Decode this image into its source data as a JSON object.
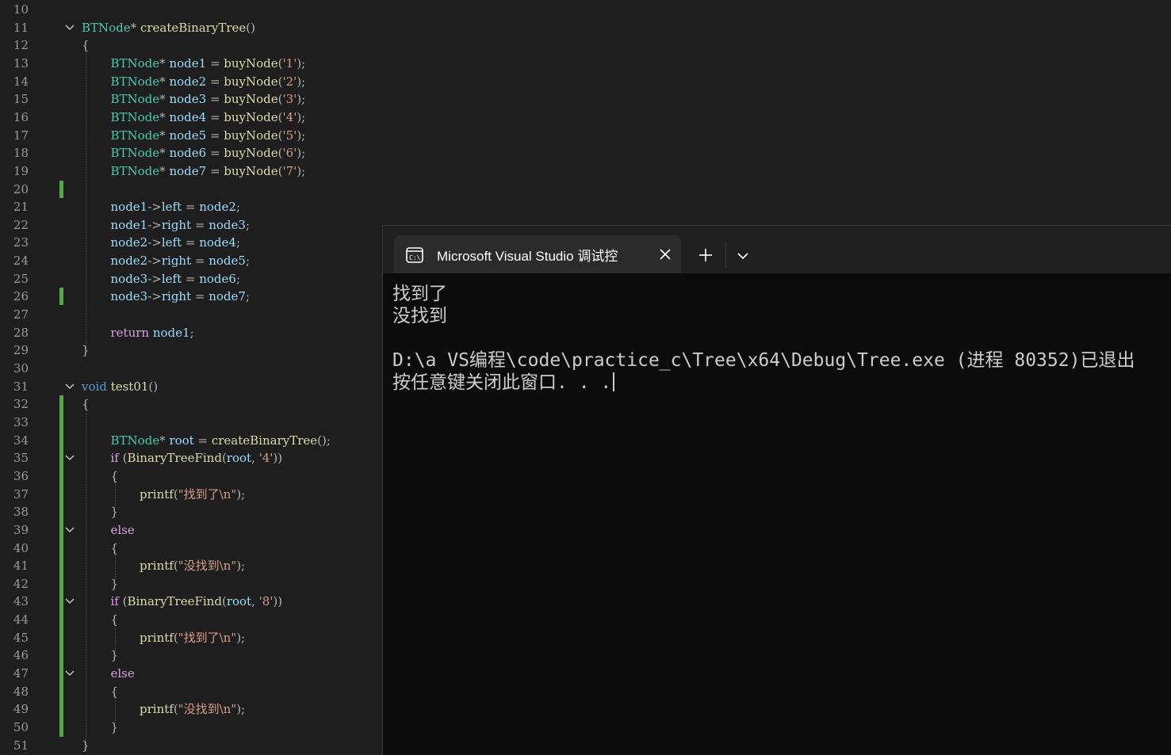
{
  "editor": {
    "lines": [
      {
        "n": "10",
        "tokens": []
      },
      {
        "n": "11",
        "fold": true,
        "indent": 0,
        "tokens": [
          [
            "ty",
            "BTNode"
          ],
          [
            "pun",
            "* "
          ],
          [
            "fn",
            "createBinaryTree"
          ],
          [
            "pun",
            "()"
          ]
        ]
      },
      {
        "n": "12",
        "indent": 0,
        "tokens": [
          [
            "pun",
            "{"
          ]
        ]
      },
      {
        "n": "13",
        "indent": 1,
        "tokens": [
          [
            "ty",
            "BTNode"
          ],
          [
            "pun",
            "* "
          ],
          [
            "var",
            "node1"
          ],
          [
            "pun",
            " = "
          ],
          [
            "fn",
            "buyNode"
          ],
          [
            "pun",
            "("
          ],
          [
            "str",
            "'1'"
          ],
          [
            "pun",
            ");"
          ]
        ]
      },
      {
        "n": "14",
        "indent": 1,
        "tokens": [
          [
            "ty",
            "BTNode"
          ],
          [
            "pun",
            "* "
          ],
          [
            "var",
            "node2"
          ],
          [
            "pun",
            " = "
          ],
          [
            "fn",
            "buyNode"
          ],
          [
            "pun",
            "("
          ],
          [
            "str",
            "'2'"
          ],
          [
            "pun",
            ");"
          ]
        ]
      },
      {
        "n": "15",
        "indent": 1,
        "tokens": [
          [
            "ty",
            "BTNode"
          ],
          [
            "pun",
            "* "
          ],
          [
            "var",
            "node3"
          ],
          [
            "pun",
            " = "
          ],
          [
            "fn",
            "buyNode"
          ],
          [
            "pun",
            "("
          ],
          [
            "str",
            "'3'"
          ],
          [
            "pun",
            ");"
          ]
        ]
      },
      {
        "n": "16",
        "indent": 1,
        "tokens": [
          [
            "ty",
            "BTNode"
          ],
          [
            "pun",
            "* "
          ],
          [
            "var",
            "node4"
          ],
          [
            "pun",
            " = "
          ],
          [
            "fn",
            "buyNode"
          ],
          [
            "pun",
            "("
          ],
          [
            "str",
            "'4'"
          ],
          [
            "pun",
            ");"
          ]
        ]
      },
      {
        "n": "17",
        "indent": 1,
        "tokens": [
          [
            "ty",
            "BTNode"
          ],
          [
            "pun",
            "* "
          ],
          [
            "var",
            "node5"
          ],
          [
            "pun",
            " = "
          ],
          [
            "fn",
            "buyNode"
          ],
          [
            "pun",
            "("
          ],
          [
            "str",
            "'5'"
          ],
          [
            "pun",
            ");"
          ]
        ]
      },
      {
        "n": "18",
        "indent": 1,
        "tokens": [
          [
            "ty",
            "BTNode"
          ],
          [
            "pun",
            "* "
          ],
          [
            "var",
            "node6"
          ],
          [
            "pun",
            " = "
          ],
          [
            "fn",
            "buyNode"
          ],
          [
            "pun",
            "("
          ],
          [
            "str",
            "'6'"
          ],
          [
            "pun",
            ");"
          ]
        ]
      },
      {
        "n": "19",
        "indent": 1,
        "tokens": [
          [
            "ty",
            "BTNode"
          ],
          [
            "pun",
            "* "
          ],
          [
            "var",
            "node7"
          ],
          [
            "pun",
            " = "
          ],
          [
            "fn",
            "buyNode"
          ],
          [
            "pun",
            "("
          ],
          [
            "str",
            "'7'"
          ],
          [
            "pun",
            ");"
          ]
        ]
      },
      {
        "n": "20",
        "tokens": []
      },
      {
        "n": "21",
        "indent": 1,
        "tokens": [
          [
            "var",
            "node1"
          ],
          [
            "pun",
            "->"
          ],
          [
            "var",
            "left"
          ],
          [
            "pun",
            " = "
          ],
          [
            "var",
            "node2"
          ],
          [
            "pun",
            ";"
          ]
        ]
      },
      {
        "n": "22",
        "indent": 1,
        "tokens": [
          [
            "var",
            "node1"
          ],
          [
            "pun",
            "->"
          ],
          [
            "var",
            "right"
          ],
          [
            "pun",
            " = "
          ],
          [
            "var",
            "node3"
          ],
          [
            "pun",
            ";"
          ]
        ]
      },
      {
        "n": "23",
        "indent": 1,
        "tokens": [
          [
            "var",
            "node2"
          ],
          [
            "pun",
            "->"
          ],
          [
            "var",
            "left"
          ],
          [
            "pun",
            " = "
          ],
          [
            "var",
            "node4"
          ],
          [
            "pun",
            ";"
          ]
        ]
      },
      {
        "n": "24",
        "indent": 1,
        "tokens": [
          [
            "var",
            "node2"
          ],
          [
            "pun",
            "->"
          ],
          [
            "var",
            "right"
          ],
          [
            "pun",
            " = "
          ],
          [
            "var",
            "node5"
          ],
          [
            "pun",
            ";"
          ]
        ]
      },
      {
        "n": "25",
        "indent": 1,
        "tokens": [
          [
            "var",
            "node3"
          ],
          [
            "pun",
            "->"
          ],
          [
            "var",
            "left"
          ],
          [
            "pun",
            " = "
          ],
          [
            "var",
            "node6"
          ],
          [
            "pun",
            ";"
          ]
        ]
      },
      {
        "n": "26",
        "indent": 1,
        "tokens": [
          [
            "var",
            "node3"
          ],
          [
            "pun",
            "->"
          ],
          [
            "var",
            "right"
          ],
          [
            "pun",
            " = "
          ],
          [
            "var",
            "node7"
          ],
          [
            "pun",
            ";"
          ]
        ]
      },
      {
        "n": "27",
        "tokens": []
      },
      {
        "n": "28",
        "indent": 1,
        "tokens": [
          [
            "ctl",
            "return"
          ],
          [
            "pun",
            " "
          ],
          [
            "var",
            "node1"
          ],
          [
            "pun",
            ";"
          ]
        ]
      },
      {
        "n": "29",
        "indent": 0,
        "tokens": [
          [
            "pun",
            "}"
          ]
        ]
      },
      {
        "n": "30",
        "tokens": []
      },
      {
        "n": "31",
        "fold": true,
        "indent": 0,
        "tokens": [
          [
            "kw",
            "void"
          ],
          [
            "pun",
            " "
          ],
          [
            "fn",
            "test01"
          ],
          [
            "pun",
            "()"
          ]
        ]
      },
      {
        "n": "32",
        "indent": 0,
        "tokens": [
          [
            "pun",
            "{"
          ]
        ]
      },
      {
        "n": "33",
        "tokens": []
      },
      {
        "n": "34",
        "indent": 1,
        "tokens": [
          [
            "ty",
            "BTNode"
          ],
          [
            "pun",
            "* "
          ],
          [
            "var",
            "root"
          ],
          [
            "pun",
            " = "
          ],
          [
            "fn",
            "createBinaryTree"
          ],
          [
            "pun",
            "();"
          ]
        ]
      },
      {
        "n": "35",
        "fold": true,
        "indent": 1,
        "tokens": [
          [
            "ctl",
            "if"
          ],
          [
            "pun",
            " ("
          ],
          [
            "fn",
            "BinaryTreeFind"
          ],
          [
            "pun",
            "("
          ],
          [
            "var",
            "root"
          ],
          [
            "pun",
            ", "
          ],
          [
            "str",
            "'4'"
          ],
          [
            "pun",
            "))"
          ]
        ]
      },
      {
        "n": "36",
        "indent": 1,
        "tokens": [
          [
            "pun",
            "{"
          ]
        ]
      },
      {
        "n": "37",
        "indent": 2,
        "tokens": [
          [
            "fn",
            "printf"
          ],
          [
            "pun",
            "("
          ],
          [
            "str",
            "\"找到了\\n\""
          ],
          [
            "pun",
            ");"
          ]
        ]
      },
      {
        "n": "38",
        "indent": 1,
        "tokens": [
          [
            "pun",
            "}"
          ]
        ]
      },
      {
        "n": "39",
        "fold": true,
        "indent": 1,
        "tokens": [
          [
            "ctl",
            "else"
          ]
        ]
      },
      {
        "n": "40",
        "indent": 1,
        "tokens": [
          [
            "pun",
            "{"
          ]
        ]
      },
      {
        "n": "41",
        "indent": 2,
        "tokens": [
          [
            "fn",
            "printf"
          ],
          [
            "pun",
            "("
          ],
          [
            "str",
            "\"没找到\\n\""
          ],
          [
            "pun",
            ");"
          ]
        ]
      },
      {
        "n": "42",
        "indent": 1,
        "tokens": [
          [
            "pun",
            "}"
          ]
        ]
      },
      {
        "n": "43",
        "fold": true,
        "indent": 1,
        "tokens": [
          [
            "ctl",
            "if"
          ],
          [
            "pun",
            " ("
          ],
          [
            "fn",
            "BinaryTreeFind"
          ],
          [
            "pun",
            "("
          ],
          [
            "var",
            "root"
          ],
          [
            "pun",
            ", "
          ],
          [
            "str",
            "'8'"
          ],
          [
            "pun",
            "))"
          ]
        ]
      },
      {
        "n": "44",
        "indent": 1,
        "tokens": [
          [
            "pun",
            "{"
          ]
        ]
      },
      {
        "n": "45",
        "indent": 2,
        "tokens": [
          [
            "fn",
            "printf"
          ],
          [
            "pun",
            "("
          ],
          [
            "str",
            "\"找到了\\n\""
          ],
          [
            "pun",
            ");"
          ]
        ]
      },
      {
        "n": "46",
        "indent": 1,
        "tokens": [
          [
            "pun",
            "}"
          ]
        ]
      },
      {
        "n": "47",
        "fold": true,
        "indent": 1,
        "tokens": [
          [
            "ctl",
            "else"
          ]
        ]
      },
      {
        "n": "48",
        "indent": 1,
        "tokens": [
          [
            "pun",
            "{"
          ]
        ]
      },
      {
        "n": "49",
        "indent": 2,
        "tokens": [
          [
            "fn",
            "printf"
          ],
          [
            "pun",
            "("
          ],
          [
            "str",
            "\"没找到\\n\""
          ],
          [
            "pun",
            ");"
          ]
        ]
      },
      {
        "n": "50",
        "indent": 1,
        "tokens": [
          [
            "pun",
            "}"
          ]
        ]
      },
      {
        "n": "51",
        "indent": 0,
        "tokens": [
          [
            "pun",
            "}"
          ]
        ]
      }
    ]
  },
  "terminal": {
    "tab_title": "Microsoft Visual Studio 调试控",
    "tab_icon": "console-icon",
    "close_icon": "close-icon",
    "new_tab_icon": "plus-icon",
    "dropdown_icon": "chevron-down-icon",
    "output": [
      "找到了",
      "没找到",
      "",
      "D:\\a VS编程\\code\\practice_c\\Tree\\x64\\Debug\\Tree.exe (进程 80352)已退出",
      "按任意键关闭此窗口. . ."
    ]
  }
}
